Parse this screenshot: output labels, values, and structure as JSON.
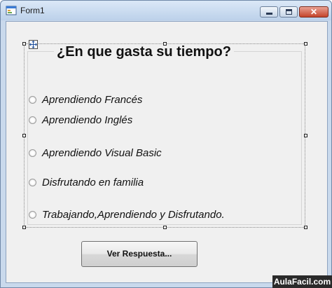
{
  "window": {
    "title": "Form1"
  },
  "group": {
    "question": "¿En que gasta su tiempo?"
  },
  "options": [
    "Aprendiendo Francés",
    "Aprendiendo Inglés",
    "Aprendiendo Visual Basic",
    "Disfrutando en familia",
    "Trabajando,Aprendiendo y Disfrutando."
  ],
  "button": {
    "label": "Ver Respuesta..."
  },
  "watermark": "AulaFacil.com",
  "icons": {
    "app": "form-app-icon",
    "minimize": "minimize-icon",
    "maximize": "maximize-icon",
    "close": "close-icon",
    "move": "move-handle-icon"
  },
  "colors": {
    "window_frame": "#c9d9ec",
    "close_button": "#c4442b",
    "client_background": "#f0f0f0"
  }
}
